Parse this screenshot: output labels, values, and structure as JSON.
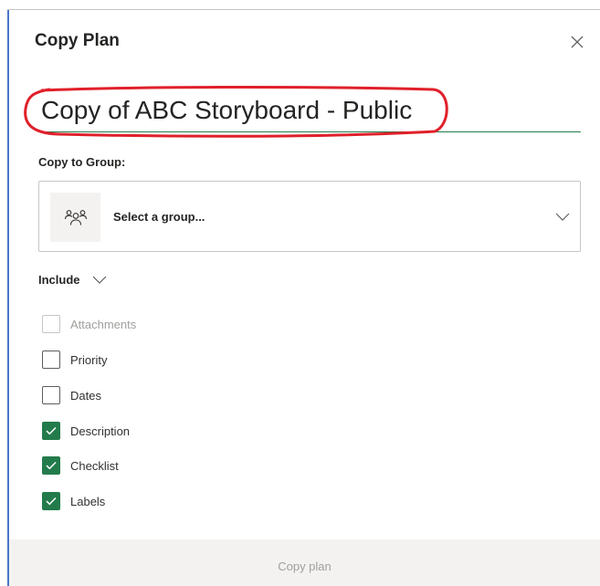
{
  "dialog": {
    "title": "Copy Plan",
    "close_icon": "close-icon"
  },
  "plan_name": {
    "value": "Copy of ABC Storyboard - Public",
    "highlight_color": "#e0202a"
  },
  "group": {
    "label": "Copy to Group:",
    "placeholder": "Select a group...",
    "avatar_icon": "group-people-icon",
    "chevron_icon": "chevron-down-icon"
  },
  "include": {
    "label": "Include",
    "chevron_icon": "chevron-down-icon",
    "options": [
      {
        "label": "Attachments",
        "checked": false,
        "disabled": true
      },
      {
        "label": "Priority",
        "checked": false,
        "disabled": false
      },
      {
        "label": "Dates",
        "checked": false,
        "disabled": false
      },
      {
        "label": "Description",
        "checked": true,
        "disabled": false
      },
      {
        "label": "Checklist",
        "checked": true,
        "disabled": false
      },
      {
        "label": "Labels",
        "checked": true,
        "disabled": false
      }
    ]
  },
  "footer": {
    "copy_button_label": "Copy plan",
    "copy_button_disabled": true
  },
  "colors": {
    "accent": "#237b4b",
    "window_edge": "#4a76c8",
    "footer_bg": "#f3f2f1"
  }
}
